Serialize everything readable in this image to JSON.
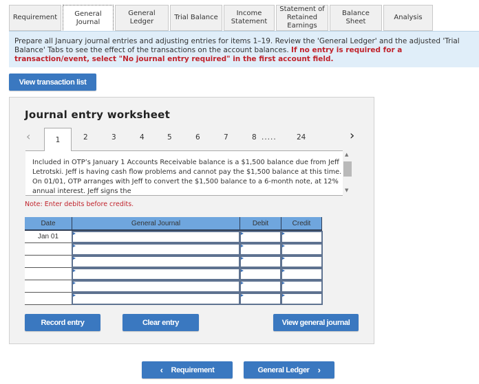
{
  "tabs": [
    {
      "label": "Requirement",
      "active": false
    },
    {
      "label": "General Journal",
      "active": true
    },
    {
      "label": "General Ledger",
      "active": false
    },
    {
      "label": "Trial Balance",
      "active": false
    },
    {
      "label": "Income Statement",
      "active": false
    },
    {
      "label": "Statement of Retained Earnings",
      "active": false
    },
    {
      "label": "Balance Sheet",
      "active": false
    },
    {
      "label": "Analysis",
      "active": false
    }
  ],
  "instructions": {
    "text": "Prepare all January journal entries and adjusting entries for items 1–19. Review the 'General Ledger' and the adjusted 'Trial Balance' Tabs to see the effect of the transactions on the account balances. ",
    "emphasis": "If no entry is required for a transaction/event, select \"No journal entry required\" in the first account field."
  },
  "view_transaction_list_label": "View transaction list",
  "worksheet": {
    "title": "Journal entry worksheet",
    "pager": {
      "prev_icon": "chevron-left-icon",
      "next_icon": "chevron-right-icon",
      "pages": [
        "1",
        "2",
        "3",
        "4",
        "5",
        "6",
        "7",
        "8"
      ],
      "ellipsis": ".....",
      "last": "24",
      "current": "1"
    },
    "description": "Included in OTP’s January 1 Accounts Receivable balance is a $1,500 balance due from Jeff Letrotski. Jeff is having cash flow problems and cannot pay the $1,500 balance at this time. On 01/01, OTP arranges with Jeff to convert the $1,500 balance to a 6-month note, at 12% annual interest. Jeff signs the",
    "note": "Note: Enter debits before credits.",
    "table": {
      "headers": {
        "date": "Date",
        "journal": "General Journal",
        "debit": "Debit",
        "credit": "Credit"
      },
      "rows": [
        {
          "date": "Jan 01",
          "account": "",
          "debit": "",
          "credit": ""
        },
        {
          "date": "",
          "account": "",
          "debit": "",
          "credit": ""
        },
        {
          "date": "",
          "account": "",
          "debit": "",
          "credit": ""
        },
        {
          "date": "",
          "account": "",
          "debit": "",
          "credit": ""
        },
        {
          "date": "",
          "account": "",
          "debit": "",
          "credit": ""
        },
        {
          "date": "",
          "account": "",
          "debit": "",
          "credit": ""
        }
      ]
    },
    "buttons": {
      "record": "Record entry",
      "clear": "Clear entry",
      "view_journal": "View general journal"
    }
  },
  "nav": {
    "prev_label": "Requirement",
    "next_label": "General Ledger"
  },
  "colors": {
    "button_blue": "#3a78c0",
    "header_blue": "#6fa6de",
    "alert_red": "#c0232c",
    "instruction_bg": "#e0eef9"
  }
}
